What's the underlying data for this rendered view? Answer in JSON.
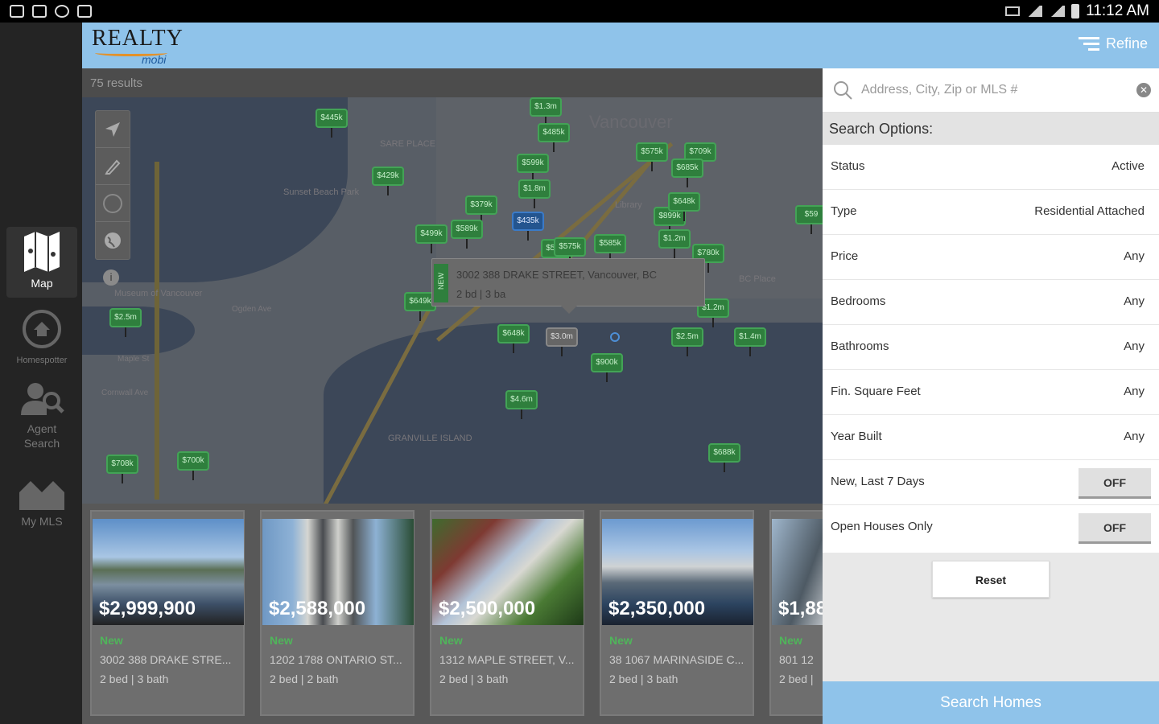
{
  "status_bar": {
    "time": "11:12 AM",
    "left_icons": [
      "screenshot-icon",
      "sd-card-icon",
      "sync-icon",
      "notification-icon"
    ],
    "right_icons": [
      "vibrate-icon",
      "wifi-icon",
      "signal-icon",
      "battery-icon"
    ]
  },
  "sidebar": {
    "items": [
      {
        "label": "Map",
        "icon": "map-icon",
        "active": true
      },
      {
        "label": "Homespotter",
        "icon": "home-icon",
        "active": false
      },
      {
        "label": "Agent\nSearch",
        "icon": "agent-search-icon",
        "active": false
      },
      {
        "label": "My MLS",
        "icon": "my-mls-icon",
        "active": false
      }
    ]
  },
  "header": {
    "logo_main": "REALTY",
    "logo_sub": "mobi",
    "refine_label": "Refine"
  },
  "results": {
    "count_text": "75 results"
  },
  "map": {
    "labels": [
      "Vancouver",
      "Sunset Beach Park",
      "Library",
      "BC Place",
      "Museum of Vancouver",
      "Cornwall Ave",
      "GRANVILLE ISLAND",
      "SARE PLACE",
      "Ogden Ave",
      "Maple St"
    ],
    "pins": [
      {
        "label": "$445k"
      },
      {
        "label": "$1.3m"
      },
      {
        "label": "$485k"
      },
      {
        "label": "$575k"
      },
      {
        "label": "$709k"
      },
      {
        "label": "$599k"
      },
      {
        "label": "$685k"
      },
      {
        "label": "$1.8m"
      },
      {
        "label": "$429k"
      },
      {
        "label": "$379k"
      },
      {
        "label": "$499k"
      },
      {
        "label": "$435k"
      },
      {
        "label": "$589k"
      },
      {
        "label": "$589k"
      },
      {
        "label": "$899k"
      },
      {
        "label": "$648k"
      },
      {
        "label": "$1.2m"
      },
      {
        "label": "$585k"
      },
      {
        "label": "$780k"
      },
      {
        "label": "$59"
      },
      {
        "label": "$2.5m"
      },
      {
        "label": "$1.2m"
      },
      {
        "label": "$2.5m"
      },
      {
        "label": "$648k"
      },
      {
        "label": "$1.4m"
      },
      {
        "label": "$649k"
      },
      {
        "label": "$3.0m"
      },
      {
        "label": "$900k"
      },
      {
        "label": "$4.6m"
      },
      {
        "label": "$708k"
      },
      {
        "label": "$700k"
      },
      {
        "label": "$688k"
      },
      {
        "label": "$575k"
      }
    ],
    "popup": {
      "address": "3002 388 DRAKE STREET, Vancouver, BC",
      "beds": "2 bd | 3 ba",
      "tag": "NEW"
    }
  },
  "listings": [
    {
      "price": "$2,999,900",
      "tag": "New",
      "address": "3002 388 DRAKE STRE...",
      "beds": "2 bed | 3 bath"
    },
    {
      "price": "$2,588,000",
      "tag": "New",
      "address": "1202 1788 ONTARIO ST...",
      "beds": "2 bed | 2 bath"
    },
    {
      "price": "$2,500,000",
      "tag": "New",
      "address": "1312 MAPLE STREET, V...",
      "beds": "2 bed | 3 bath"
    },
    {
      "price": "$2,350,000",
      "tag": "New",
      "address": "38 1067 MARINASIDE C...",
      "beds": "2 bed | 3 bath"
    },
    {
      "price": "$1,88",
      "tag": "New",
      "address": "801 12",
      "beds": "2 bed |"
    }
  ],
  "panel": {
    "search_placeholder": "Address, City, Zip or MLS #",
    "search_value": "",
    "options_header": "Search Options:",
    "options": [
      {
        "label": "Status",
        "value": "Active"
      },
      {
        "label": "Type",
        "value": "Residential Attached"
      },
      {
        "label": "Price",
        "value": "Any"
      },
      {
        "label": "Bedrooms",
        "value": "Any"
      },
      {
        "label": "Bathrooms",
        "value": "Any"
      },
      {
        "label": "Fin. Square Feet",
        "value": "Any"
      },
      {
        "label": "Year Built",
        "value": "Any"
      }
    ],
    "toggles": [
      {
        "label": "New, Last 7 Days",
        "value": "OFF"
      },
      {
        "label": "Open Houses Only",
        "value": "OFF"
      }
    ],
    "reset_label": "Reset",
    "search_homes_label": "Search Homes"
  },
  "colors": {
    "header_blue": "#8fc3ea",
    "pin_green": "#2f7f3d",
    "new_green": "#4fb65a",
    "sidebar_dark": "#242424"
  }
}
